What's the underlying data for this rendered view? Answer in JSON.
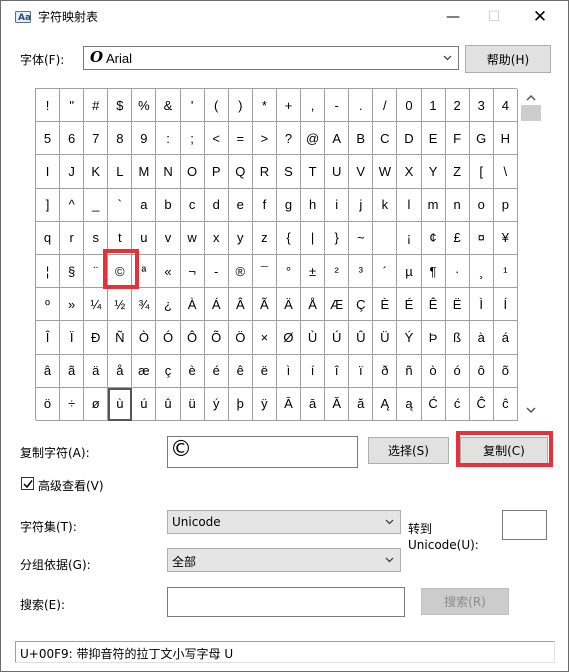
{
  "window": {
    "title": "字符映射表",
    "minimize_label": "—",
    "maximize_label": "☐",
    "close_label": "✕"
  },
  "font": {
    "label": "字体(F):",
    "icon_glyph": "O",
    "value": "Arial",
    "help_button": "帮助(H)"
  },
  "grid": {
    "chars": [
      "!",
      "\"",
      "#",
      "$",
      "%",
      "&",
      "'",
      "(",
      ")",
      "*",
      "+",
      ",",
      "-",
      ".",
      "/",
      "0",
      "1",
      "2",
      "3",
      "4",
      "5",
      "6",
      "7",
      "8",
      "9",
      ":",
      ";",
      "<",
      "=",
      ">",
      "?",
      "@",
      "A",
      "B",
      "C",
      "D",
      "E",
      "F",
      "G",
      "H",
      "I",
      "J",
      "K",
      "L",
      "M",
      "N",
      "O",
      "P",
      "Q",
      "R",
      "S",
      "T",
      "U",
      "V",
      "W",
      "X",
      "Y",
      "Z",
      "[",
      "\\",
      "]",
      "^",
      "_",
      "`",
      "a",
      "b",
      "c",
      "d",
      "e",
      "f",
      "g",
      "h",
      "i",
      "j",
      "k",
      "l",
      "m",
      "n",
      "o",
      "p",
      "q",
      "r",
      "s",
      "t",
      "u",
      "v",
      "w",
      "x",
      "y",
      "z",
      "{",
      "|",
      "}",
      "~",
      " ",
      "¡",
      "¢",
      "£",
      "¤",
      "¥",
      "¦",
      "§",
      "¨",
      "©",
      "ª",
      "«",
      "¬",
      "-",
      "®",
      "¯",
      "°",
      "±",
      "²",
      "³",
      "´",
      "µ",
      "¶",
      "·",
      "¸",
      "¹",
      "º",
      "»",
      "¼",
      "½",
      "¾",
      "¿",
      "À",
      "Á",
      "Â",
      "Ã",
      "Ä",
      "Å",
      "Æ",
      "Ç",
      "È",
      "É",
      "Ê",
      "Ë",
      "Ì",
      "Í",
      "Î",
      "Ï",
      "Ð",
      "Ñ",
      "Ò",
      "Ó",
      "Ô",
      "Õ",
      "Ö",
      "×",
      "Ø",
      "Ù",
      "Ú",
      "Û",
      "Ü",
      "Ý",
      "Þ",
      "ß",
      "à",
      "á",
      "â",
      "ã",
      "ä",
      "å",
      "æ",
      "ç",
      "è",
      "é",
      "ê",
      "ë",
      "ì",
      "í",
      "î",
      "ï",
      "ð",
      "ñ",
      "ò",
      "ó",
      "ô",
      "õ",
      "ö",
      "÷",
      "ø",
      "ù",
      "ú",
      "û",
      "ü",
      "ý",
      "þ",
      "ÿ",
      "Ā",
      "ā",
      "Ă",
      "ă",
      "Ą",
      "ą",
      "Ć",
      "ć",
      "Ĉ",
      "ĉ"
    ],
    "highlighted_char": "©",
    "current_char": "ù",
    "scroll_up_icon": "chevron-up-icon",
    "scroll_down_icon": "chevron-down-icon"
  },
  "copy": {
    "label": "复制字符(A):",
    "value": "©",
    "select_button": "选择(S)",
    "copy_button": "复制(C)"
  },
  "advanced_view": {
    "label": "高级查看(V)",
    "checked": true
  },
  "charset": {
    "label": "字符集(T):",
    "value": "Unicode",
    "goto_label_1": "转到",
    "goto_label_2": "Unicode(U):",
    "goto_value": ""
  },
  "group_by": {
    "label": "分组依据(G):",
    "value": "全部"
  },
  "search": {
    "label": "搜索(E):",
    "value": "",
    "button": "搜索(R)"
  },
  "status": {
    "text": "U+00F9: 带抑音符的拉丁文小写字母 U"
  },
  "colors": {
    "highlight_red": "#e8303a",
    "grid_line": "#a0a0a0",
    "button_face": "#e1e1e1"
  }
}
